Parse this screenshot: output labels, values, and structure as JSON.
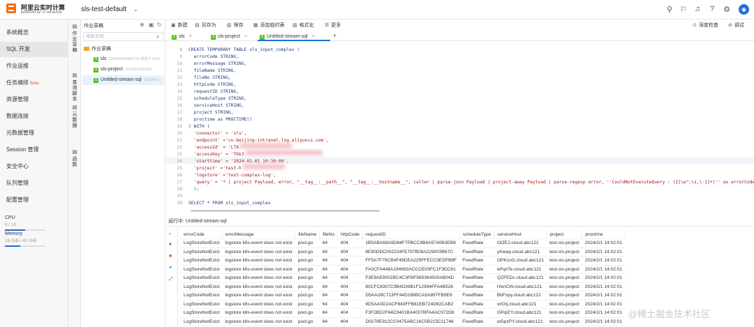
{
  "app": {
    "brand": "阿里云实时计算",
    "powered": "powered by ⊙ ververica",
    "project": "sls-test-default"
  },
  "nav": {
    "items": [
      "系统概览",
      "SQL 开发",
      "作业运维",
      "任务编排",
      "资源管理",
      "数据连接",
      "元数据管理",
      "Session 管理",
      "安全中心",
      "队列管理",
      "配置管理"
    ],
    "beta": "Beta",
    "cpu_label": "CPU",
    "cpu_val": "5 / 10",
    "cpu_frac": 0.5,
    "mem_label": "Memory",
    "mem_val": "15 GiB / 40 GiB",
    "mem_frac": 0.375
  },
  "vtabs": [
    "作业草稿",
    "查询脚本",
    "元数据",
    "函数"
  ],
  "tree": {
    "title": "作业草稿",
    "search_placeholder": "搜索名称",
    "folder": "作业草稿",
    "nodes": [
      {
        "name": "sls",
        "meta": "1326464090868733 修改于 2024",
        "icon": "S"
      },
      {
        "name": "sls-project",
        "meta": "13268640683487",
        "icon": "S"
      },
      {
        "name": "Untitled-stream-sql",
        "meta": "13264640",
        "icon": "S"
      }
    ]
  },
  "toolbar": {
    "items": [
      "新建",
      "另存为",
      "保存",
      "添加临时表",
      "格式化",
      "更多"
    ],
    "deep_check": "深度检查",
    "debug": "调试"
  },
  "tabs": [
    "sls",
    "sls-project",
    "Untitled-stream-sql"
  ],
  "code": {
    "line_numbers": [
      "8",
      "9",
      "10",
      "11",
      "12",
      "13",
      "14",
      "15",
      "16",
      "17",
      "18",
      "19",
      "20",
      "21",
      "22",
      "23",
      "24",
      "25",
      "26",
      "27",
      "28",
      "29",
      "30"
    ],
    "lines": [
      "CREATE TEMPORARY TABLE sls_input_complex (",
      "  errorCode STRING,",
      "  errorMessage STRING,",
      "  fileName STRING,",
      "  fileNo STRING,",
      "  httpCode STRING,",
      "  requestID STRING,",
      "  scheduleType STRING,",
      "  serviceHost STRING,",
      "  project STRING,",
      "  proctime as PROCTIME()",
      ") WITH (",
      "  'connector' = 'sls',",
      "  'endpoint' ='cn-beijing-intranet.log.aliyuncs.com',",
      "  'accessId' = 'LTA",
      "  'accessKey' = 'T6k3",
      "  'starttime' = '2024-02-01 10:30:00',",
      "  'project' ='test-h",
      "  'logstore' ='test-complex-log',",
      "  'query' = '* | project Payload, error, \"__tag__:__path__\", \"__tag__:__hostname__\", caller | parse-json Payload | project-away Payload | parse-regexp error, ''CouldNotExecuteQuery : ({[\\w\":\\s,\\-}]+)'' as errorCode, errorMessage | parse-json errorCode, errorMessage | par",
      "  );",
      "",
      "SELECT * FROM sls_input_complex"
    ]
  },
  "status": "运行中: Untitled-stream-sql",
  "results": {
    "columns": [
      "errorCode",
      "errorMessage",
      "fileName",
      "fileNo",
      "httpCode",
      "requestID",
      "scheduleType",
      "serviceHost",
      "project",
      "proctime"
    ],
    "rows": [
      [
        "LogStoreNotExist",
        "logstore k8s-event does not exist",
        "pool.go",
        "64",
        "404",
        "1B5ABA68A9D84F7FBCC8B4A5740B3EB9",
        "FixedRate",
        "OIZEJ.cloud.abc121",
        "test-sls-project",
        "2024/2/1 14:02:01"
      ],
      [
        "LogStoreNotExist",
        "logstore k8s-event does not exist",
        "pool.go",
        "64",
        "404",
        "8E80DDC002224FE797B08A229003B67C",
        "FixedRate",
        "yKieep.cloud.abc121",
        "test-sls-project",
        "2024/2/1 14:02:01"
      ],
      [
        "LogStoreNotExist",
        "logstore k8s-event does not exist",
        "pool.go",
        "64",
        "404",
        "FF5A7F79CB4F49DEA225FFECC3EDFB8F",
        "FixedRate",
        "OPKzuG.cloud.abc121",
        "test-sls-project",
        "2024/2/1 14:02:01"
      ],
      [
        "LogStoreNotExist",
        "logstore k8s-event does not exist",
        "pool.go",
        "64",
        "404",
        "FA0CFA448A194693ACCCE03FC1F3DC81",
        "FixedRate",
        "ePqnTe.cloud.abc121",
        "test-sls-project",
        "2024/2/1 14:02:01"
      ],
      [
        "LogStoreNotExist",
        "logstore k8s-event does not exist",
        "pool.go",
        "64",
        "404",
        "F3E9AE9002BC4C3FBF985364500AB04D",
        "FixedRate",
        "QZFEDc.cloud.abc121",
        "test-sls-project",
        "2024/2/1 14:02:01"
      ],
      [
        "LogStoreNotExist",
        "logstore k8s-event does not exist",
        "pool.go",
        "64",
        "404",
        "80CFC8307C9B4D39B1F12994FFA4B526",
        "FixedRate",
        "lYenCW.cloud.abc121",
        "test-sls-project",
        "2024/2/1 14:02:01"
      ],
      [
        "LogStoreNotExist",
        "logstore k8s-event does not exist",
        "pool.go",
        "64",
        "404",
        "D5AA28C713FF44D186BCA5A897FB9E6",
        "FixedRate",
        "BbFxpy.cloud.abc121",
        "test-sls-project",
        "2024/2/1 14:02:01"
      ],
      [
        "LogStoreNotExist",
        "logstore k8s-event does not exist",
        "pool.go",
        "64",
        "404",
        "9D5AA0D2ACF843FFB81EB724D82CAB2",
        "FixedRate",
        "virGIj.cloud.abc121",
        "test-sls-project",
        "2024/2/1 14:02:01"
      ],
      [
        "LogStoreNotExist",
        "logstore k8s-event does not exist",
        "pool.go",
        "64",
        "404",
        "F3F2BD2F64D3401BA4007BFA4AC972D8",
        "FixedRate",
        "GPqIZY.cloud.abc121",
        "test-sls-project",
        "2024/2/1 14:02:01"
      ],
      [
        "LogStoreNotExist",
        "logstore k8s-event does not exist",
        "pool.go",
        "64",
        "404",
        "D0278E912CC0475ABC16C5B215C11746",
        "FixedRate",
        "wGpzPY.cloud.abc121",
        "test-sls-project",
        "2024/2/1 14:02:01"
      ]
    ]
  },
  "watermark": "@稀土掘金技术社区"
}
